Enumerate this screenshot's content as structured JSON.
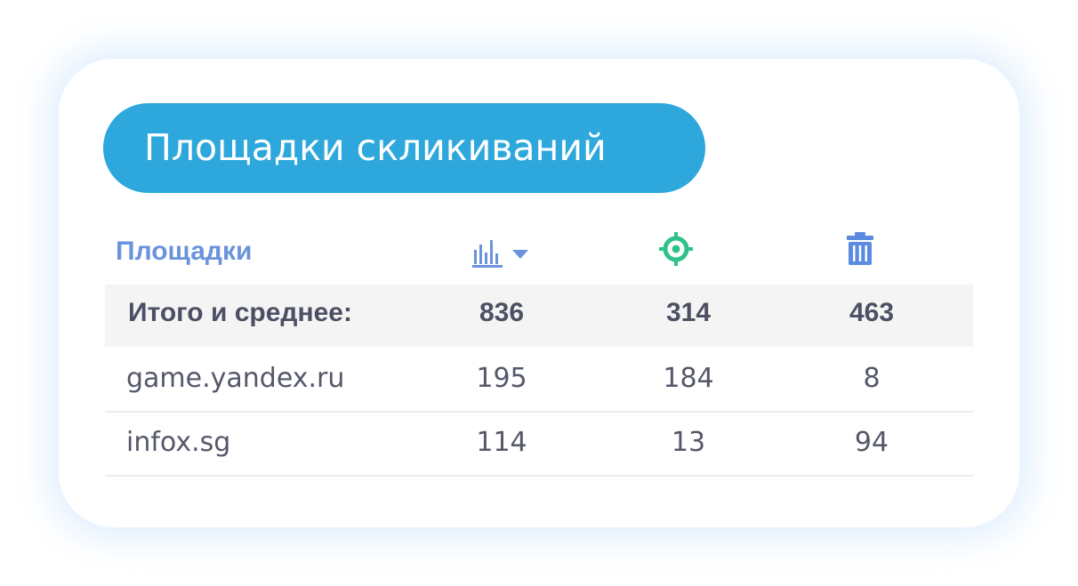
{
  "card": {
    "title": "Площадки скликиваний"
  },
  "table": {
    "headers": {
      "site_label": "Площадки",
      "col1_icon": "bar-chart-sort-icon",
      "col2_icon": "target-icon",
      "col3_icon": "trash-icon"
    },
    "total": {
      "label": "Итого и среднее:",
      "values": [
        "836",
        "314",
        "463"
      ]
    },
    "rows": [
      {
        "site": "game.yandex.ru",
        "values": [
          "195",
          "184",
          "8"
        ]
      },
      {
        "site": "infox.sg",
        "values": [
          "114",
          "13",
          "94"
        ]
      }
    ]
  },
  "colors": {
    "accent": "#2ea8dc",
    "header_text": "#6b93dc",
    "target_icon": "#2ec28a",
    "trash_icon": "#5b8be0"
  }
}
